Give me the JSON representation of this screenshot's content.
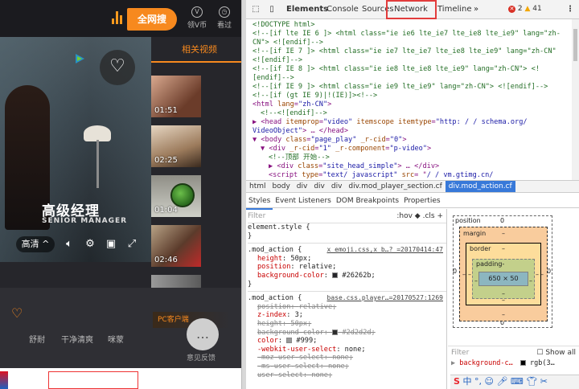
{
  "site": {
    "search_button": "全网搜",
    "top_icons": [
      {
        "glyph": "V",
        "label": "领V币",
        "icon": "vcoin-icon"
      },
      {
        "glyph": "◷",
        "label": "看过",
        "icon": "history-icon"
      }
    ],
    "video": {
      "sign_cn": "高级经理",
      "sign_en": "SENIOR MANAGER",
      "quality": "高清 ^"
    },
    "related_tab": "相关视频",
    "thumbnails": [
      {
        "duration": "01:51"
      },
      {
        "duration": "02:25"
      },
      {
        "duration": "01:04"
      },
      {
        "duration": "02:46"
      },
      {
        "duration": ""
      }
    ],
    "tags": [
      "舒耐",
      "干净清爽",
      "咪蒙"
    ],
    "ad_text": "PC客户端",
    "feedback_label": "意见反馈"
  },
  "devtools": {
    "tabs": [
      "Elements",
      "Console",
      "Sources",
      "Network",
      "Timeline",
      "»"
    ],
    "errors": "2",
    "warnings": "41",
    "dom_lines": [
      {
        "indent": 0,
        "parts": [
          [
            "c",
            "<!DOCTYPE html>"
          ]
        ]
      },
      {
        "indent": 0,
        "parts": [
          [
            "c",
            "<!--[if lte IE 6 ]> <html class=\"ie ie6 lte_ie7 lte_ie8 lte_ie9\" lang=\"zh-"
          ]
        ]
      },
      {
        "indent": 0,
        "parts": [
          [
            "c",
            "CN\"> <![endif]-->"
          ]
        ]
      },
      {
        "indent": 0,
        "parts": [
          [
            "c",
            "<!--[if IE 7 ]> <html class=\"ie ie7 lte_ie7 lte_ie8 lte_ie9\" lang=\"zh-CN\""
          ]
        ]
      },
      {
        "indent": 0,
        "parts": [
          [
            "c",
            "<![endif]-->"
          ]
        ]
      },
      {
        "indent": 0,
        "parts": [
          [
            "c",
            "<!--[if IE 8 ]> <html class=\"ie ie8 lte_ie8 lte_ie9\" lang=\"zh-CN\"> <!"
          ]
        ]
      },
      {
        "indent": 0,
        "parts": [
          [
            "c",
            "[endif]-->"
          ]
        ]
      },
      {
        "indent": 0,
        "parts": [
          [
            "c",
            "<!--[if IE 9 ]> <html class=\"ie ie9 lte_ie9\" lang=\"zh-CN\"> <![endif]-->"
          ]
        ]
      },
      {
        "indent": 0,
        "parts": [
          [
            "c",
            "<!--[if (gt IE 9)|!(IE)]><!-->"
          ]
        ]
      },
      {
        "indent": 0,
        "parts": [
          [
            "t",
            "<html "
          ],
          [
            "a",
            "lang"
          ],
          [
            "t",
            "="
          ],
          [
            "v",
            "\"zh-CN\""
          ],
          [
            "t",
            ">"
          ]
        ]
      },
      {
        "indent": 1,
        "parts": [
          [
            "c",
            "<!--<![endif]-->"
          ]
        ]
      },
      {
        "indent": 0,
        "parts": [
          [
            "t",
            "▶ <head "
          ],
          [
            "a",
            "itemprop"
          ],
          [
            "t",
            "="
          ],
          [
            "v",
            "\"video\""
          ],
          [
            "t",
            " "
          ],
          [
            "a",
            "itemscope itemtype"
          ],
          [
            "t",
            "="
          ],
          [
            "v",
            "\"http: / / schema.org/"
          ]
        ]
      },
      {
        "indent": 0,
        "parts": [
          [
            "v",
            "VideoObject\""
          ],
          [
            "t",
            "> … </head>"
          ]
        ]
      },
      {
        "indent": 0,
        "parts": [
          [
            "t",
            "▼ <body "
          ],
          [
            "a",
            "class"
          ],
          [
            "t",
            "="
          ],
          [
            "v",
            "\"page_play\""
          ],
          [
            "t",
            " "
          ],
          [
            "a",
            "_r-cid"
          ],
          [
            "t",
            "="
          ],
          [
            "v",
            "\"0\""
          ],
          [
            "t",
            ">"
          ]
        ]
      },
      {
        "indent": 1,
        "parts": [
          [
            "t",
            "▼ <div "
          ],
          [
            "a",
            "_r-cid"
          ],
          [
            "t",
            "="
          ],
          [
            "v",
            "\"1\""
          ],
          [
            "t",
            " "
          ],
          [
            "a",
            "_r-component"
          ],
          [
            "t",
            "="
          ],
          [
            "v",
            "\"p-video\""
          ],
          [
            "t",
            ">"
          ]
        ]
      },
      {
        "indent": 2,
        "parts": [
          [
            "c",
            "<!--顶部 开始-->"
          ]
        ]
      },
      {
        "indent": 2,
        "parts": [
          [
            "t",
            "▶ <div "
          ],
          [
            "a",
            "class"
          ],
          [
            "t",
            "="
          ],
          [
            "v",
            "\"site_head_simple\""
          ],
          [
            "t",
            "> … </div>"
          ]
        ]
      },
      {
        "indent": 2,
        "parts": [
          [
            "t",
            "<script "
          ],
          [
            "a",
            "type"
          ],
          [
            "t",
            "="
          ],
          [
            "v",
            "\"text/ javascript\""
          ],
          [
            "t",
            " "
          ],
          [
            "a",
            "src"
          ],
          [
            "t",
            "= \""
          ],
          [
            "v",
            "/ / vm.gtimg.cn/"
          ]
        ]
      }
    ],
    "breadcrumbs": [
      "html",
      "body",
      "div",
      "div",
      "div",
      "div.mod_player_section.cf",
      "div.mod_action.cf"
    ],
    "subtabs": [
      "Styles",
      "Event Listeners",
      "DOM Breakpoints",
      "Properties"
    ],
    "filter_placeholder": "Filter",
    "filter_tools": ":hov  ◆  .cls  +",
    "rules": [
      {
        "selector": "element.style {",
        "source": "",
        "props": [],
        "close": "}"
      },
      {
        "selector": ".mod_action {",
        "source": "x_emoji.css,x_b…? =20170414:47",
        "props": [
          {
            "name": "height",
            "value": "50px;",
            "struck": false
          },
          {
            "name": "position",
            "value": "relative;",
            "struck": false
          },
          {
            "name": "background-color",
            "value": "#26262b;",
            "struck": false,
            "swatch": "#26262b"
          }
        ],
        "close": "}"
      },
      {
        "selector": ".mod_action {",
        "source": "base.css.player…=20170527:1269",
        "props": [
          {
            "name": "position",
            "value": "relative;",
            "struck": true
          },
          {
            "name": "z-index",
            "value": "3;",
            "struck": false
          },
          {
            "name": "height",
            "value": "50px;",
            "struck": true
          },
          {
            "name": "background-color",
            "value": "#2d2d2d;",
            "struck": true,
            "swatch": "#2d2d2d"
          },
          {
            "name": "color",
            "value": "#999;",
            "struck": false,
            "swatch": "#999999"
          },
          {
            "name": "-webkit-user-select",
            "value": "none;",
            "struck": false
          },
          {
            "name": "-moz-user-select",
            "value": "none;",
            "struck": true
          },
          {
            "name": "-ms-user-select",
            "value": "none;",
            "struck": true
          },
          {
            "name": "user-select",
            "value": "none;",
            "struck": true
          }
        ],
        "close": ""
      }
    ],
    "box_model": {
      "position_label": "position",
      "position_value": "0",
      "margin_label": "margin",
      "margin_value": "–",
      "border_label": "border",
      "border_value": "–",
      "padding_label": "padding-",
      "padding_value": "–",
      "content": "650 × 50"
    },
    "filter2": "Filter",
    "show_all": "Show all",
    "computed": {
      "name": "background-c…",
      "value": "rgb(3…"
    },
    "colors": {
      "selected_crumb": "#3879d9",
      "network_highlight": "#e23c3c"
    }
  }
}
